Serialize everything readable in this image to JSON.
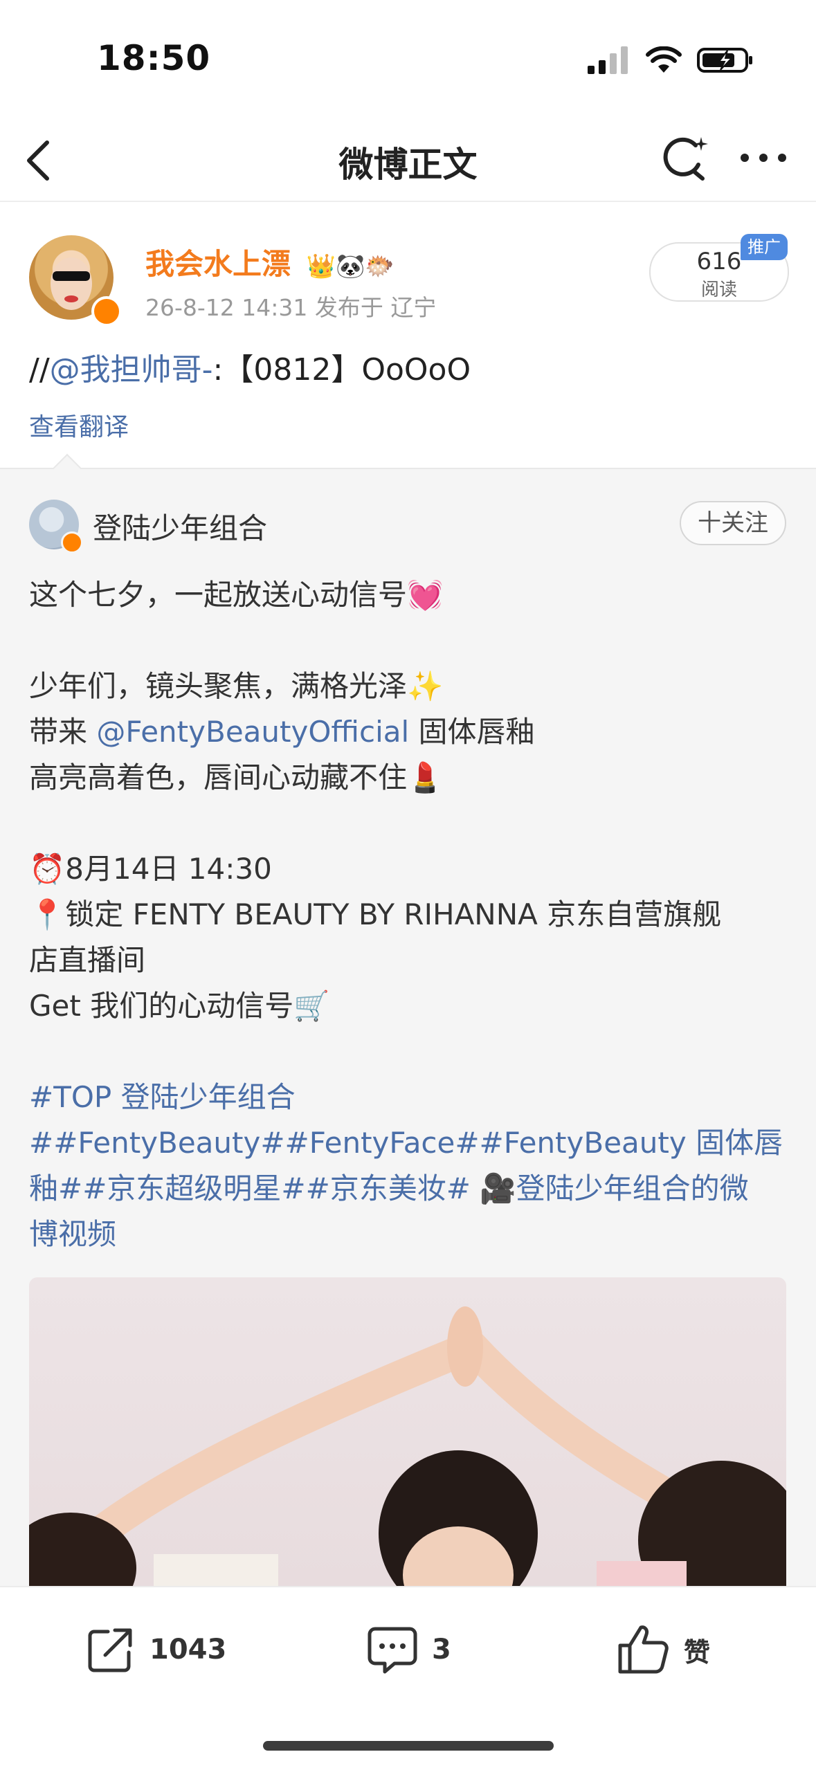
{
  "status_bar": {
    "time": "18:50"
  },
  "nav": {
    "title": "微博正文"
  },
  "post": {
    "username": "我会水上漂",
    "emoji_badges": "👑🐼🐡",
    "meta": "26-8-12 14:31  发布于 辽宁",
    "read_count": "616",
    "read_label": "阅读",
    "promo_badge": "推广",
    "text_prefix": "//",
    "text_mention": "@我担帅哥-",
    "text_rest": ":【0812】OoOoO",
    "translate_label": "查看翻译"
  },
  "repost": {
    "author": "登陆少年组合",
    "follow_label": "十关注",
    "lines": {
      "l1": "这个七夕，一起放送心动信号💓",
      "l2": "少年们，镜头聚焦，满格光泽✨",
      "l3_a": "带来 ",
      "l3_mention": "@FentyBeautyOfficial",
      "l3_b": " 固体唇釉",
      "l4": "高亮高着色，唇间心动藏不住💄",
      "l5": "⏰8月14日 14:30",
      "l6": "📍锁定 FENTY BEAUTY BY RIHANNA 京东自营旗舰",
      "l7": "店直播间",
      "l8": "Get 我们的心动信号🛒",
      "l9": "#TOP 登陆少年组合",
      "l10": "##FentyBeauty##FentyFace##FentyBeauty 固体唇",
      "l11": "釉##京东超级明星##京东美妆# 🎥登陆少年组合的微",
      "l12": "博视频"
    }
  },
  "actions": {
    "repost_count": "1043",
    "comment_count": "3",
    "like_label": "赞"
  },
  "colors": {
    "username": "#f37b1d",
    "link": "#4a6ea8",
    "promo": "#4f8ae0",
    "verified": "#ff8200"
  }
}
